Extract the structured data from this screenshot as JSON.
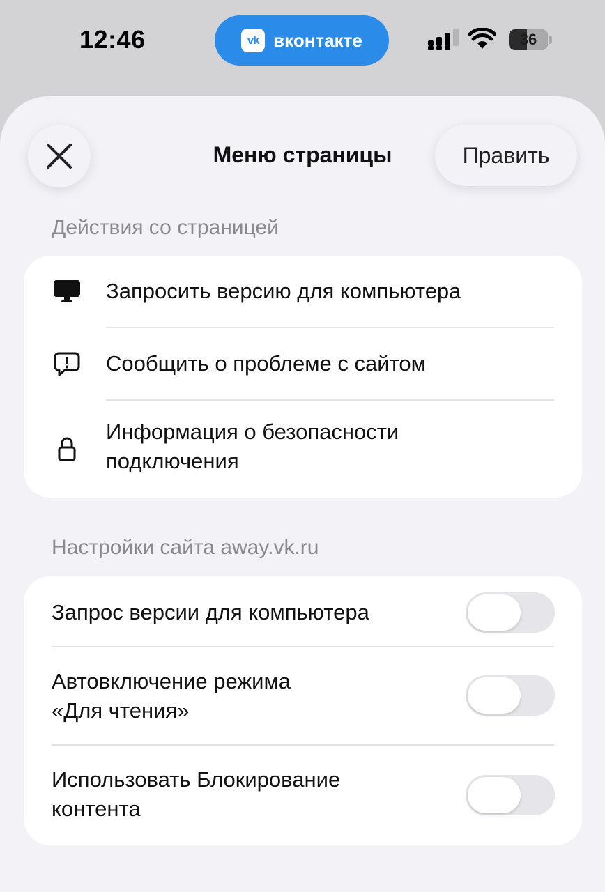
{
  "status_bar": {
    "time": "12:46",
    "app_pill": {
      "logo": "vk",
      "name": "вконтакте",
      "color": "#2a8be8"
    },
    "battery": "36",
    "icons": [
      "signal-icon",
      "wifi-icon",
      "battery-icon"
    ]
  },
  "sheet": {
    "title": "Меню страницы",
    "close_icon": "close-icon",
    "edit_label": "Править"
  },
  "page_actions": {
    "header": "Действия со страницей",
    "items": [
      {
        "icon": "desktop-icon",
        "label": "Запросить версию для компьютера"
      },
      {
        "icon": "report-bubble-icon",
        "label": "Сообщить о проблеме с сайтом"
      },
      {
        "icon": "lock-icon",
        "label": "Информация о безопасности подключения"
      }
    ]
  },
  "site_settings": {
    "header": "Настройки сайта away.vk.ru",
    "items": [
      {
        "label": "Запрос версии для компьютера",
        "enabled": false
      },
      {
        "label": "Автовключение режима «Для чтения»",
        "enabled": false
      },
      {
        "label": "Использовать Блокирование контента",
        "enabled": false
      }
    ]
  }
}
